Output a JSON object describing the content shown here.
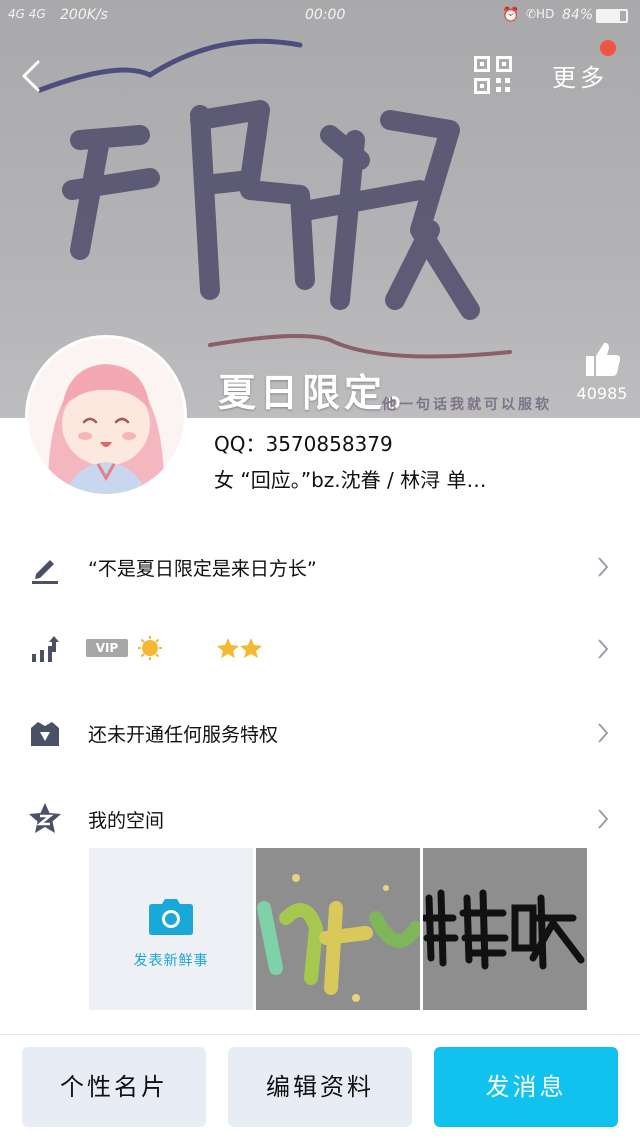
{
  "status_bar": {
    "network": "4G 4G",
    "speed": "200K/s",
    "time": "00:00",
    "battery": "84%"
  },
  "top_bar": {
    "back_icon": "back-arrow-icon",
    "qr_icon": "qr-code-icon",
    "more_label": "更多"
  },
  "banner": {
    "signature": "夏日限定。",
    "subtext": "他一句话我就可以服软",
    "like_count": "40985"
  },
  "profile": {
    "qq": "QQ：3570858379",
    "info": "女 “回应。”bz.沈眷 / 林浔 单…"
  },
  "rows": {
    "signature": "“不是夏日限定是来日方长”",
    "vip_badge": "VIP",
    "service": "还未开通任何服务特权",
    "space": "我的空间"
  },
  "space": {
    "post_label": "发表新鲜事"
  },
  "bottom": {
    "card": "个性名片",
    "edit": "编辑资料",
    "message": "发消息"
  },
  "colors": {
    "accent": "#12c2ee",
    "badge_dot": "#f4533f"
  }
}
